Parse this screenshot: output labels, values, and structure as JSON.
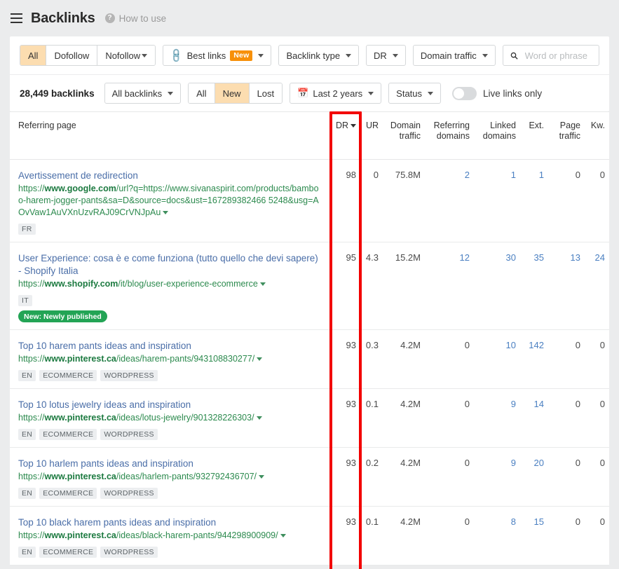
{
  "header": {
    "title": "Backlinks",
    "how_to_use": "How to use",
    "menu_icon": "hamburger-icon",
    "help_icon": "question-mark-icon"
  },
  "filters": {
    "follow_segment": [
      {
        "label": "All",
        "active": true
      },
      {
        "label": "Dofollow",
        "active": false
      },
      {
        "label": "Nofollow",
        "active": false,
        "caret": true
      }
    ],
    "best_links": {
      "label": "Best links",
      "badge": "New",
      "icon": "link-chain-icon"
    },
    "backlink_type": "Backlink type",
    "dr": "DR",
    "domain_traffic": "Domain traffic",
    "search": {
      "placeholder": "Word or phrase",
      "value": "",
      "icon": "search-icon"
    }
  },
  "subfilters": {
    "count": "28,449 backlinks",
    "all_backlinks": "All backlinks",
    "state_segment": [
      {
        "label": "All",
        "active": false
      },
      {
        "label": "New",
        "active": true
      },
      {
        "label": "Lost",
        "active": false
      }
    ],
    "date_range": {
      "label": "Last 2 years",
      "icon": "calendar-icon"
    },
    "status": "Status",
    "live_links_toggle": {
      "label": "Live links only",
      "on": false
    }
  },
  "table": {
    "columns": [
      {
        "key": "referring_page",
        "label": "Referring page",
        "align": "left"
      },
      {
        "key": "dr",
        "label": "DR",
        "sorted": true
      },
      {
        "key": "ur",
        "label": "UR"
      },
      {
        "key": "domain_traffic",
        "label": "Domain traffic"
      },
      {
        "key": "referring_domains",
        "label": "Referring domains"
      },
      {
        "key": "linked_domains",
        "label": "Linked domains"
      },
      {
        "key": "ext",
        "label": "Ext."
      },
      {
        "key": "page_traffic",
        "label": "Page traffic"
      },
      {
        "key": "kw",
        "label": "Kw."
      }
    ],
    "rows": [
      {
        "title": "Avertissement de redirection",
        "url_prefix": "https://",
        "url_domain": "www.google.com",
        "url_path": "/url?q=https://www.sivanaspirit.com/products/bamboo-harem-jogger-pants&sa=D&source=docs&ust=167289382466 5248&usg=AOvVaw1AuVXnUzvRAJ09CrVNJpAu",
        "tags": [
          "FR"
        ],
        "pill": null,
        "dr": "98",
        "ur": "0",
        "domain_traffic": "75.8M",
        "referring_domains": "2",
        "referring_domains_link": true,
        "linked_domains": "1",
        "linked_domains_link": true,
        "ext": "1",
        "ext_link": true,
        "page_traffic": "0",
        "page_traffic_link": false,
        "kw": "0",
        "kw_link": false
      },
      {
        "title": "User Experience: cosa è e come funziona (tutto quello che devi sapere) - Shopify Italia",
        "url_prefix": "https://",
        "url_domain": "www.shopify.com",
        "url_path": "/it/blog/user-experience-ecommerce",
        "tags": [
          "IT"
        ],
        "pill": "New: Newly published",
        "dr": "95",
        "ur": "4.3",
        "domain_traffic": "15.2M",
        "referring_domains": "12",
        "referring_domains_link": true,
        "linked_domains": "30",
        "linked_domains_link": true,
        "ext": "35",
        "ext_link": true,
        "page_traffic": "13",
        "page_traffic_link": true,
        "kw": "24",
        "kw_link": true
      },
      {
        "title": "Top 10 harem pants ideas and inspiration",
        "url_prefix": "https://",
        "url_domain": "www.pinterest.ca",
        "url_path": "/ideas/harem-pants/943108830277/",
        "tags": [
          "EN",
          "ECOMMERCE",
          "WORDPRESS"
        ],
        "pill": null,
        "dr": "93",
        "ur": "0.3",
        "domain_traffic": "4.2M",
        "referring_domains": "0",
        "referring_domains_link": false,
        "linked_domains": "10",
        "linked_domains_link": true,
        "ext": "142",
        "ext_link": true,
        "page_traffic": "0",
        "page_traffic_link": false,
        "kw": "0",
        "kw_link": false
      },
      {
        "title": "Top 10 lotus jewelry ideas and inspiration",
        "url_prefix": "https://",
        "url_domain": "www.pinterest.ca",
        "url_path": "/ideas/lotus-jewelry/901328226303/",
        "tags": [
          "EN",
          "ECOMMERCE",
          "WORDPRESS"
        ],
        "pill": null,
        "dr": "93",
        "ur": "0.1",
        "domain_traffic": "4.2M",
        "referring_domains": "0",
        "referring_domains_link": false,
        "linked_domains": "9",
        "linked_domains_link": true,
        "ext": "14",
        "ext_link": true,
        "page_traffic": "0",
        "page_traffic_link": false,
        "kw": "0",
        "kw_link": false
      },
      {
        "title": "Top 10 harlem pants ideas and inspiration",
        "url_prefix": "https://",
        "url_domain": "www.pinterest.ca",
        "url_path": "/ideas/harlem-pants/932792436707/",
        "tags": [
          "EN",
          "ECOMMERCE",
          "WORDPRESS"
        ],
        "pill": null,
        "dr": "93",
        "ur": "0.2",
        "domain_traffic": "4.2M",
        "referring_domains": "0",
        "referring_domains_link": false,
        "linked_domains": "9",
        "linked_domains_link": true,
        "ext": "20",
        "ext_link": true,
        "page_traffic": "0",
        "page_traffic_link": false,
        "kw": "0",
        "kw_link": false
      },
      {
        "title": "Top 10 black harem pants ideas and inspiration",
        "url_prefix": "https://",
        "url_domain": "www.pinterest.ca",
        "url_path": "/ideas/black-harem-pants/944298900909/",
        "tags": [
          "EN",
          "ECOMMERCE",
          "WORDPRESS"
        ],
        "pill": null,
        "dr": "93",
        "ur": "0.1",
        "domain_traffic": "4.2M",
        "referring_domains": "0",
        "referring_domains_link": false,
        "linked_domains": "8",
        "linked_domains_link": true,
        "ext": "15",
        "ext_link": true,
        "page_traffic": "0",
        "page_traffic_link": false,
        "kw": "0",
        "kw_link": false
      }
    ]
  },
  "annotation": {
    "color": "#f20000",
    "target_column": "DR"
  }
}
